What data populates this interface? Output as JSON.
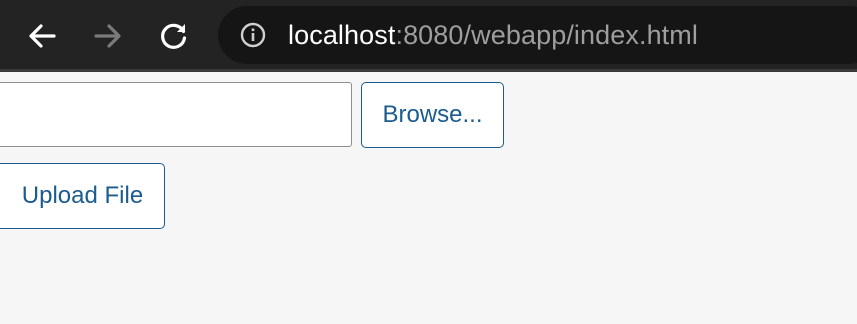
{
  "browser": {
    "icons": {
      "back": "arrow-left-icon",
      "forward": "arrow-right-icon",
      "reload": "reload-icon",
      "site_info": "info-icon"
    },
    "url": {
      "host": "localhost",
      "rest": ":8080/webapp/index.html"
    }
  },
  "form": {
    "file_input_value": "",
    "browse_label": "Browse...",
    "upload_label": "Upload File"
  },
  "colors": {
    "toolbar_bg": "#232323",
    "omnibox_bg": "#151515",
    "button_text": "#1b5b8e",
    "page_bg": "#f6f6f6"
  }
}
